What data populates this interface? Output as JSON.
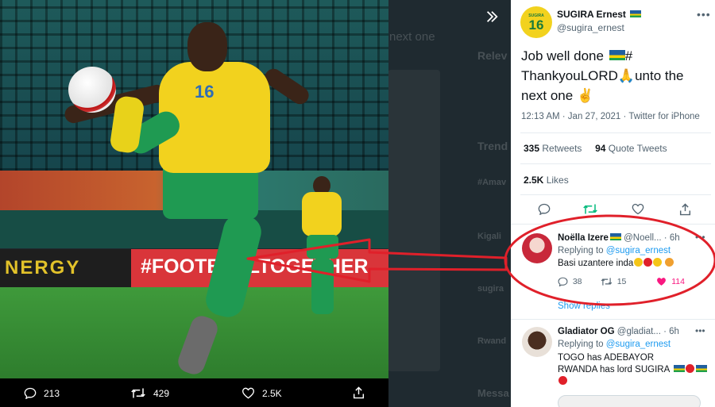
{
  "viewer": {
    "ghost_next_one": "next one",
    "ghost_labels": [
      "Relev",
      "Trend",
      "#Amav",
      "Kigali",
      "sugira",
      "Rwand",
      "Messa"
    ],
    "photo": {
      "jersey_number": "16",
      "board_left_text": "NERGY",
      "board_right_text": "#FOOTBALLTOGETHER"
    },
    "actions": {
      "replies": "213",
      "retweets": "429",
      "likes": "2.5K"
    }
  },
  "tweet": {
    "author_name": "SUGIRA Ernest",
    "author_handle": "@sugira_ernest",
    "avatar_caption": "SUGIRA",
    "avatar_number": "16",
    "text_line1": "Job well done",
    "text_hash": "#",
    "text_line2": "ThankyouLORD",
    "text_line2b": "unto the",
    "text_line3": "next one",
    "timestamp": "12:13 AM · Jan 27, 2021 · Twitter for iPhone",
    "retweets_count": "335",
    "retweets_label": "Retweets",
    "quotes_count": "94",
    "quotes_label": "Quote Tweets",
    "likes_count": "2.5K",
    "likes_label": "Likes"
  },
  "replies": [
    {
      "name": "Noëlla Izere",
      "handle": "@Noell...",
      "time": "· 6h",
      "replying_label": "Replying to",
      "replying_to": "@sugira_ernest",
      "body": "Basi uzantere inda",
      "reply_count": "38",
      "retweet_count": "15",
      "like_count": "114"
    },
    {
      "name": "Gladiator OG",
      "handle": "@gladiat...",
      "time": "· 6h",
      "replying_label": "Replying to",
      "replying_to": "@sugira_ernest",
      "body_line1": "TOGO has ADEBAYOR",
      "body_line2": "RWANDA has lord SUGIRA"
    }
  ],
  "show_replies": "Show replies",
  "colors": {
    "accent": "#1d9bf0",
    "annotation": "#e0202a",
    "like_red": "#f91880",
    "retweet_green": "#00ba7c"
  }
}
